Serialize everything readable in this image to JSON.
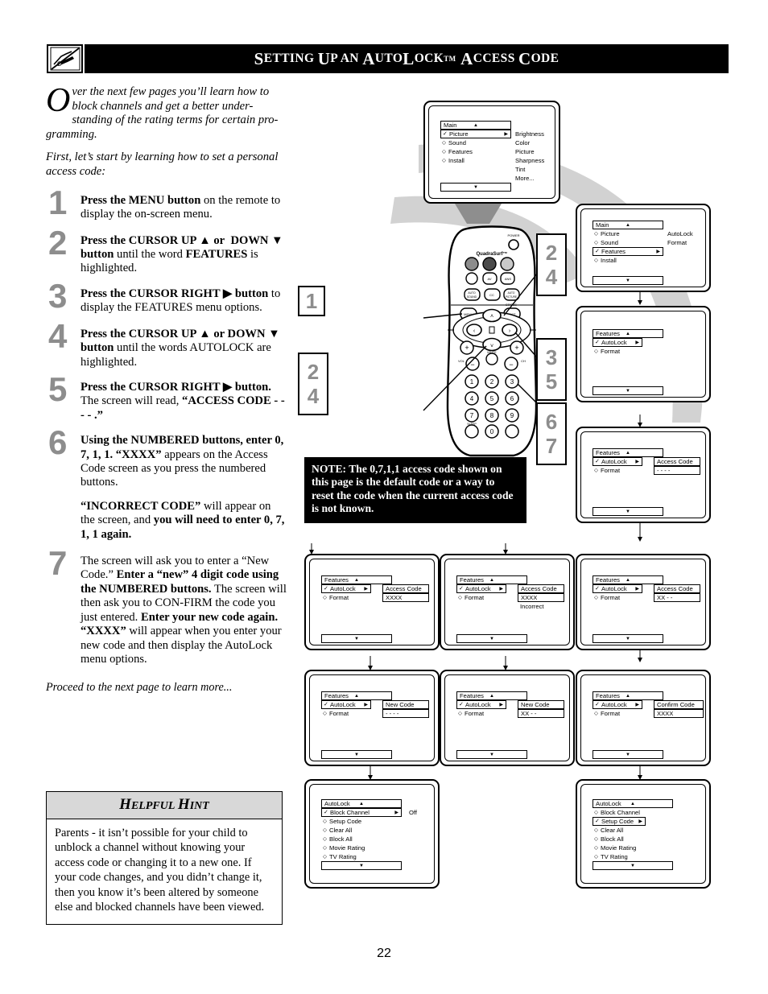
{
  "header": {
    "title_parts": [
      "S",
      "ETTING ",
      "U",
      "P AN ",
      "A",
      "UTO",
      "L",
      "OCK",
      "™ ",
      "A",
      "CCESS ",
      "C",
      "ODE"
    ],
    "title_plain": "Setting Up an AutoLock™ Access Code",
    "icon": "hand-writing-crossed-icon"
  },
  "intro": {
    "dropcap": "O",
    "p1": "ver the next few pages you’ll learn how to block channels and get a better under­standing of the rating terms for certain pro­gramming.",
    "p1_rest": "ver the next few pages you’ll learn how to block channels and get a better understanding of the rating terms for certain programming.",
    "p2": "First, let’s start by learning how to set a personal access code:"
  },
  "steps": [
    {
      "num": "1",
      "html": "<b>Press the MENU button</b> on the remote to display the on-screen menu."
    },
    {
      "num": "2",
      "html": "<b>Press the CURSOR UP ▲ or  DOWN ▼ button</b> until the word <b>FEATURES</b> is highlighted."
    },
    {
      "num": "3",
      "html": "<b>Press the CURSOR RIGHT ▶ button</b> to display the FEATURES menu options."
    },
    {
      "num": "4",
      "html": "<b>Press the CURSOR UP ▲ or DOWN ▼ button</b> until the words AUTOLOCK are highlighted."
    },
    {
      "num": "5",
      "html": "<b>Press the CURSOR RIGHT ▶ button.</b> The screen will read, <b>“ACCESS CODE - - - - .”</b>"
    },
    {
      "num": "6",
      "html": "<b>Using the NUMBERED buttons, enter 0, 7, 1, 1. “XXXX”</b> appears on the Access Code screen as you press the numbered buttons."
    },
    {
      "num": "7",
      "html": "The screen will ask you to enter a “New Code.” <b>Enter a “new” 4 digit code using the NUMBERED buttons.</b> The screen will then ask you to CON-FIRM the code you just entered. <b>Enter your new code again. “XXXX”</b> will appear when you enter your new code and then display the AutoLock menu options."
    }
  ],
  "step6_note": "<b>“INCORRECT CODE”</b> will appear on the screen, and <b>you will need to enter 0, 7, 1, 1 again.</b>",
  "proceed": "Proceed to the next page to learn more...",
  "hint": {
    "heading_parts": [
      "H",
      "ELPFUL ",
      "H",
      "INT"
    ],
    "heading": "Helpful Hint",
    "body": "Parents - it isn’t possible for your child to unblock a channel without knowing your access code or changing it to a new one. If your code changes, and you didn’t change it, then you know it’s been altered by someone else and blocked channels have been viewed."
  },
  "note_box": {
    "text": "NOTE: The 0,7,1,1 access code shown on this page is the default code or a way to reset the code when the current access code is not known."
  },
  "page_number": "22",
  "remote": {
    "brand": "QuadraSurf™",
    "labels": {
      "power": "POWER",
      "menu": "MENU",
      "status": "STATUS",
      "exit": "EXIT",
      "mute": "MUTE",
      "sleep": "SLEEP",
      "vol": "VOL",
      "ch": "CH",
      "auto_sound": "AUTO SOUND",
      "auto_picture": "AUTO PICTURE",
      "cc": "CC",
      "av": "AV",
      "smart": "SMART"
    },
    "keypad": [
      "1",
      "2",
      "3",
      "4",
      "5",
      "6",
      "7",
      "8",
      "9",
      "0"
    ]
  },
  "callouts": [
    {
      "id": "c1",
      "label": "1"
    },
    {
      "id": "c2a",
      "label": "2"
    },
    {
      "id": "c4a",
      "label": "4"
    },
    {
      "id": "c2b",
      "label": "2"
    },
    {
      "id": "c4b",
      "label": "4"
    },
    {
      "id": "c3",
      "label": "3"
    },
    {
      "id": "c5",
      "label": "5"
    },
    {
      "id": "c6",
      "label": "6"
    },
    {
      "id": "c7",
      "label": "7"
    }
  ],
  "screens": [
    {
      "id": "screen-main-picture",
      "title": "Main",
      "rows": [
        {
          "marker": "check",
          "label": "Picture",
          "selected": true,
          "arrow": true
        },
        {
          "marker": "diamond",
          "label": "Sound"
        },
        {
          "marker": "diamond",
          "label": "Features"
        },
        {
          "marker": "diamond",
          "label": "Install"
        }
      ],
      "right_column": [
        "Brightness",
        "Color",
        "Picture",
        "Sharpness",
        "Tint",
        "More..."
      ],
      "up_arrow": "▲",
      "down_arrow": "▼"
    },
    {
      "id": "screen-main-features",
      "title": "Main",
      "rows": [
        {
          "marker": "diamond",
          "label": "Picture"
        },
        {
          "marker": "diamond",
          "label": "Sound"
        },
        {
          "marker": "check",
          "label": "Features",
          "selected": true,
          "arrow": true
        },
        {
          "marker": "diamond",
          "label": "Install"
        }
      ],
      "right_column": [
        "AutoLock",
        "Format"
      ],
      "up_arrow": "▲",
      "down_arrow": "▼"
    },
    {
      "id": "screen-features-autolock",
      "title": "Features",
      "rows": [
        {
          "marker": "check",
          "label": "AutoLock",
          "selected": true,
          "arrow": true
        },
        {
          "marker": "diamond",
          "label": "Format"
        }
      ],
      "right_column": [],
      "up_arrow": "▲",
      "down_arrow": "▼"
    },
    {
      "id": "screen-access-code-empty",
      "title": "Features",
      "rows": [
        {
          "marker": "check",
          "label": "AutoLock",
          "selected": true,
          "arrow": true
        },
        {
          "marker": "diamond",
          "label": "Format"
        }
      ],
      "value_label": "Access Code",
      "value_field": "- - - -",
      "up_arrow": "▲",
      "down_arrow": "▼"
    },
    {
      "id": "screen-access-code-xxxx",
      "title": "Features",
      "rows": [
        {
          "marker": "check",
          "label": "AutoLock",
          "selected": true,
          "arrow": true
        },
        {
          "marker": "diamond",
          "label": "Format"
        }
      ],
      "value_label": "Access Code",
      "value_field": "XXXX",
      "up_arrow": "▲",
      "down_arrow": "▼"
    },
    {
      "id": "screen-access-code-incorrect",
      "title": "Features",
      "rows": [
        {
          "marker": "check",
          "label": "AutoLock",
          "selected": true,
          "arrow": true
        },
        {
          "marker": "diamond",
          "label": "Format"
        }
      ],
      "value_label": "Access Code",
      "value_field": "XXXX",
      "extra_text": "Incorrect",
      "up_arrow": "▲",
      "down_arrow": "▼"
    },
    {
      "id": "screen-access-code-partial",
      "title": "Features",
      "rows": [
        {
          "marker": "check",
          "label": "AutoLock",
          "selected": true,
          "arrow": true
        },
        {
          "marker": "diamond",
          "label": "Format"
        }
      ],
      "value_label": "Access Code",
      "value_field": "XX - -",
      "up_arrow": "▲",
      "down_arrow": "▼"
    },
    {
      "id": "screen-new-code-empty",
      "title": "Features",
      "rows": [
        {
          "marker": "check",
          "label": "AutoLock",
          "selected": true,
          "arrow": true
        },
        {
          "marker": "diamond",
          "label": "Format"
        }
      ],
      "value_label": "New Code",
      "value_field": "- - - -",
      "up_arrow": "▲",
      "down_arrow": "▼"
    },
    {
      "id": "screen-new-code-partial",
      "title": "Features",
      "rows": [
        {
          "marker": "check",
          "label": "AutoLock",
          "selected": true,
          "arrow": true
        },
        {
          "marker": "diamond",
          "label": "Format"
        }
      ],
      "value_label": "New Code",
      "value_field": "XX - -",
      "up_arrow": "▲",
      "down_arrow": "▼"
    },
    {
      "id": "screen-confirm-code",
      "title": "Features",
      "rows": [
        {
          "marker": "check",
          "label": "AutoLock",
          "selected": true,
          "arrow": true
        },
        {
          "marker": "diamond",
          "label": "Format"
        }
      ],
      "value_label": "Confirm Code",
      "value_field": "XXXX",
      "up_arrow": "▲",
      "down_arrow": "▼"
    },
    {
      "id": "screen-autolock-block-channel",
      "title": "AutoLock",
      "rows": [
        {
          "marker": "check",
          "label": "Block Channel",
          "selected": true,
          "arrow": true,
          "value": "Off"
        },
        {
          "marker": "diamond",
          "label": "Setup Code"
        },
        {
          "marker": "diamond",
          "label": "Clear All"
        },
        {
          "marker": "diamond",
          "label": "Block All"
        },
        {
          "marker": "diamond",
          "label": "Movie Rating"
        },
        {
          "marker": "diamond",
          "label": "TV Rating"
        }
      ],
      "up_arrow": "▲",
      "down_arrow": "▼"
    },
    {
      "id": "screen-autolock-setup-code",
      "title": "AutoLock",
      "rows": [
        {
          "marker": "diamond",
          "label": "Block Channel"
        },
        {
          "marker": "check",
          "label": "Setup Code",
          "selected": true,
          "arrow": true
        },
        {
          "marker": "diamond",
          "label": "Clear All"
        },
        {
          "marker": "diamond",
          "label": "Block All"
        },
        {
          "marker": "diamond",
          "label": "Movie Rating"
        },
        {
          "marker": "diamond",
          "label": "TV Rating"
        }
      ],
      "up_arrow": "▲",
      "down_arrow": "▼"
    }
  ]
}
